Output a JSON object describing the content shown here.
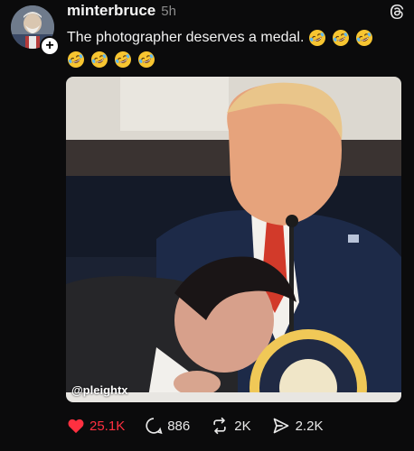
{
  "post": {
    "username": "minterbruce",
    "timestamp": "5h",
    "text": "The photographer deserves a medal.",
    "emoji_count": 7,
    "app_icon": "threads-icon"
  },
  "media": {
    "watermark": "@pleightx"
  },
  "actions": {
    "likes": "25.1K",
    "replies": "886",
    "reposts": "2K",
    "shares": "2.2K",
    "like_color": "#ff3040"
  }
}
